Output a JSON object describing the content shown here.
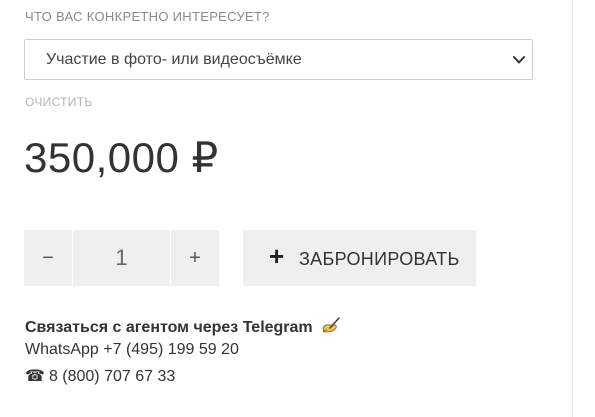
{
  "form": {
    "question_label": "ЧТО ВАС КОНКРЕТНО ИНТЕРЕСУЕТ?",
    "selected_option": "Участие в фото- или видеосъёмке",
    "clear_label": "ОЧИСТИТЬ"
  },
  "price": {
    "text": "350,000 ₽"
  },
  "quantity": {
    "minus_symbol": "−",
    "value": "1",
    "plus_symbol": "+"
  },
  "book_button": {
    "icon_symbol": "+",
    "label": "ЗАБРОНИРОВАТЬ"
  },
  "contacts": {
    "telegram_text": "Связаться с агентом через Telegram",
    "telegram_icon": "writing-hand-icon",
    "whatsapp_text": "WhatsApp +7 (495) 199 59 20",
    "phone_icon": "☎",
    "phone_text": "8 (800) 707 67 33"
  },
  "colors": {
    "button_bg": "#efefef",
    "text": "#333333",
    "muted": "#8a8a8a"
  }
}
